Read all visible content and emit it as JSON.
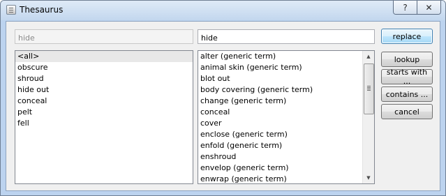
{
  "window": {
    "title": "Thesaurus",
    "caption_buttons": {
      "help": "?",
      "close": "✕"
    }
  },
  "search": {
    "original_word": "hide",
    "replacement_word": "hide"
  },
  "meanings": {
    "items": [
      "<all>",
      "obscure",
      "shroud",
      "hide out",
      "conceal",
      "pelt",
      "fell"
    ],
    "selected_index": 0
  },
  "synonyms": {
    "items": [
      "alter (generic term)",
      "animal skin (generic term)",
      "blot out",
      "body covering (generic term)",
      "change (generic term)",
      "conceal",
      "cover",
      "enclose (generic term)",
      "enfold (generic term)",
      "enshroud",
      "envelop (generic term)",
      "enwrap (generic term)"
    ],
    "scroll_up_icon": "▲",
    "scroll_down_icon": "▼"
  },
  "actions": {
    "replace": "replace",
    "lookup": "lookup",
    "starts_with": "starts with ...",
    "contains": "contains ...",
    "cancel": "cancel"
  }
}
